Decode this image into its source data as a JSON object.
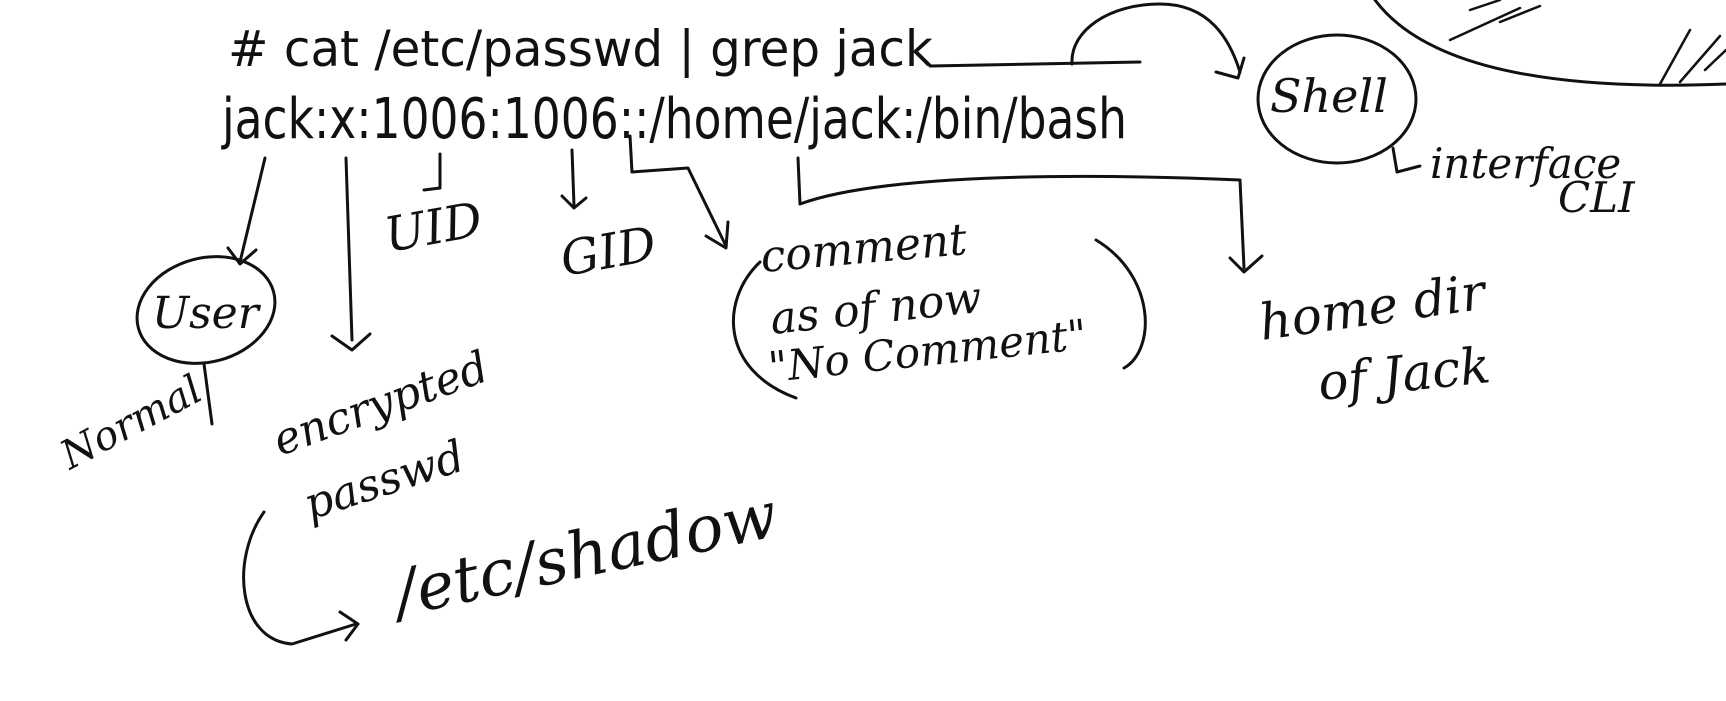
{
  "command_line": "# cat /etc/passwd | grep jack",
  "passwd_entry": "jack:x:1006:1006::/home/jack:/bin/bash",
  "labels": {
    "user": "User",
    "user_type": "Normal",
    "password": "encrypted\npasswd",
    "password_line1": "encrypted",
    "password_line2": "passwd",
    "shadow_file": "/etc/shadow",
    "uid": "UID",
    "gid": "GID",
    "comment_line1": "comment",
    "comment_line2": "as of now",
    "comment_line3": "\"No Comment\"",
    "home": "home dir\nof Jack",
    "home_line1": "home dir",
    "home_line2": "of Jack",
    "shell": "Shell",
    "shell_desc_line1": "interface",
    "shell_desc_line2": "CLI"
  },
  "colors": {
    "ink": "#111111",
    "background": "#ffffff"
  }
}
